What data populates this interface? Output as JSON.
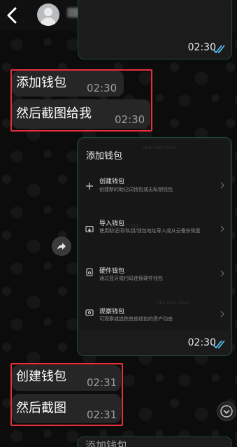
{
  "header": {
    "back_icon": "chevron-left-icon",
    "avatar_icon": "default-avatar-icon",
    "video_icon": "video-camera-icon",
    "phone_icon": "phone-icon"
  },
  "messages": {
    "top_out_time": "02:30",
    "in1_text": "添加钱包",
    "in1_time": "02:30",
    "in2_text": "然后截图给我",
    "in2_time": "02:30",
    "shot_out_time": "02:30",
    "in3_text": "创建钱包",
    "in3_time": "02:31",
    "in4_text": "然后截图",
    "in4_time": "02:31",
    "partial_text": "添加钱包"
  },
  "screenshot": {
    "title": "添加钱包",
    "items": [
      {
        "title": "创建钱包",
        "desc": "创建新的助记词钱包或无私钥钱包",
        "icon": "plus-icon"
      },
      {
        "title": "导入钱包",
        "desc": "使用助记词/私钥/钱包地址导入或从云备份恢复",
        "icon": "import-icon"
      },
      {
        "title": "硬件钱包",
        "desc": "通过蓝牙或扫码连接硬件钱包",
        "icon": "hardware-icon"
      },
      {
        "title": "观察钱包",
        "desc": "可观察或追踪其他钱包的资产动态",
        "icon": "watch-icon"
      }
    ]
  },
  "colors": {
    "highlight_box": "#e8303a",
    "bubble_outline": "#1c4a35",
    "read_ticks": "#53bdeb"
  }
}
